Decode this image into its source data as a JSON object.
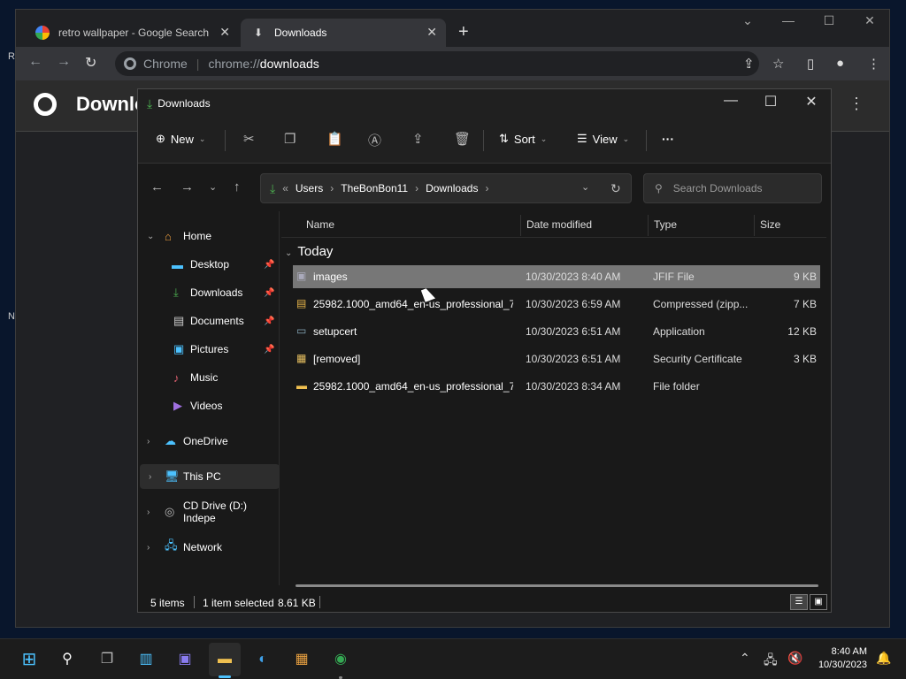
{
  "desktop": {
    "icon_letters": [
      "Re",
      "N"
    ]
  },
  "chrome": {
    "tabs": [
      {
        "label": "retro wallpaper - Google Search"
      },
      {
        "label": "Downloads"
      }
    ],
    "address": {
      "site_label": "Chrome",
      "url_prefix": "chrome://",
      "url_host": "downloads"
    },
    "page_title": "Downloads"
  },
  "explorer": {
    "title": "Downloads",
    "commands": {
      "new": "New",
      "sort": "Sort",
      "view": "View",
      "more": "···"
    },
    "breadcrumb": [
      "Users",
      "TheBonBon11",
      "Downloads"
    ],
    "search_placeholder": "Search Downloads",
    "nav": {
      "home": "Home",
      "desktop": "Desktop",
      "downloads": "Downloads",
      "documents": "Documents",
      "pictures": "Pictures",
      "music": "Music",
      "videos": "Videos",
      "onedrive": "OneDrive",
      "thispc": "This PC",
      "cddrive": "CD Drive (D:) Indepe",
      "network": "Network"
    },
    "columns": {
      "name": "Name",
      "date": "Date modified",
      "type": "Type",
      "size": "Size"
    },
    "group": "Today",
    "files": [
      {
        "name": "images",
        "date": "10/30/2023 8:40 AM",
        "type": "JFIF File",
        "size": "9 KB",
        "icon": "image-file-icon",
        "selected": true
      },
      {
        "name": "25982.1000_amd64_en-us_professional_7...",
        "date": "10/30/2023 6:59 AM",
        "type": "Compressed (zipp...",
        "size": "7 KB",
        "icon": "zip-folder-icon",
        "selected": false
      },
      {
        "name": "setupcert",
        "date": "10/30/2023 6:51 AM",
        "type": "Application",
        "size": "12 KB",
        "icon": "application-icon",
        "selected": false
      },
      {
        "name": "[removed]",
        "date": "10/30/2023 6:51 AM",
        "type": "Security Certificate",
        "size": "3 KB",
        "icon": "certificate-icon",
        "selected": false
      },
      {
        "name": "25982.1000_amd64_en-us_professional_7...",
        "date": "10/30/2023 8:34 AM",
        "type": "File folder",
        "size": "",
        "icon": "folder-icon",
        "selected": false
      }
    ],
    "status": {
      "items": "5 items",
      "selected": "1 item selected",
      "size": "8.61 KB"
    }
  },
  "taskbar": {
    "time": "8:40 AM",
    "date": "10/30/2023"
  },
  "colors": {
    "accent": "#4cc2ff",
    "selection": "#777777",
    "download_green": "#4caf50"
  }
}
